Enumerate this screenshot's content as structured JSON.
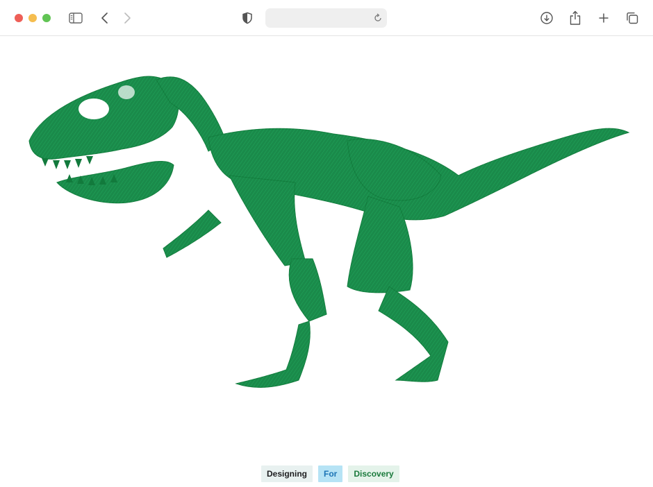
{
  "window": {
    "traffic_lights": {
      "close": "#ee5f57",
      "minimize": "#f5bd4f",
      "zoom": "#61c454"
    }
  },
  "toolbar": {
    "icons": [
      "sidebar-icon",
      "back-icon",
      "forward-icon",
      "privacy-shield-icon",
      "reload-icon",
      "download-icon",
      "share-icon",
      "new-tab-icon",
      "tab-overview-icon"
    ],
    "address_value": ""
  },
  "page": {
    "hero_image": "green t-rex skeleton illustration",
    "accent_color": "#1a8a4a",
    "tags": [
      {
        "label": "Designing"
      },
      {
        "label": "For"
      },
      {
        "label": "Discovery"
      }
    ]
  }
}
